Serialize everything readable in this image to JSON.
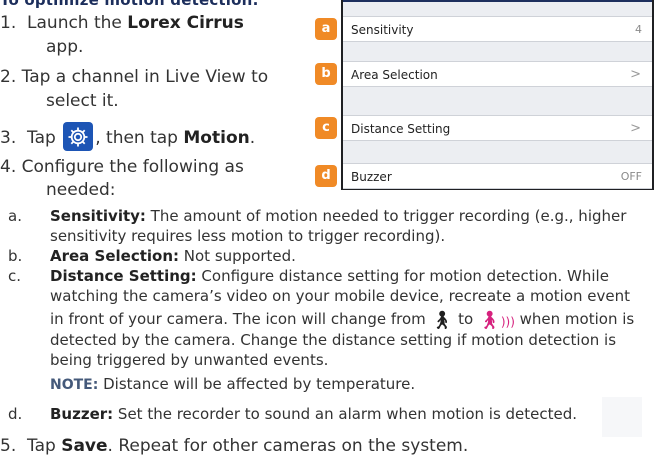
{
  "heading": "To optimize motion detection:",
  "steps": {
    "s1_prefix": "1.  Launch the ",
    "s1_bold": "Lorex Cirrus",
    "s1_cont": "app.",
    "s2_line1": "2.  Tap a channel in Live View to",
    "s2_line2": "select it.",
    "s3_prefix": "3.  Tap ",
    "s3_middle": ", then tap ",
    "s3_bold": "Motion",
    "s3_suffix": ".",
    "s4_line1": "4.  Configure the following as",
    "s4_line2": "needed:",
    "s5_prefix": "5.  Tap ",
    "s5_bold": "Save",
    "s5_suffix": ". Repeat for other cameras on the system."
  },
  "panel": {
    "rows": [
      {
        "badge": "a",
        "label": "Sensitivity",
        "value": "4"
      },
      {
        "badge": "b",
        "label": "Area Selection",
        "value": ">"
      },
      {
        "badge": "c",
        "label": "Distance Setting",
        "value": ">"
      },
      {
        "badge": "d",
        "label": "Buzzer",
        "value": "OFF"
      }
    ]
  },
  "items": {
    "a_letter": "a.",
    "a_bold": "Sensitivity:",
    "a_text1": " The amount of motion needed to trigger recording (e.g., higher",
    "a_text2": "sensitivity requires less motion to trigger recording).",
    "b_letter": "b.",
    "b_bold": "Area Selection:",
    "b_text": " Not supported.",
    "c_letter": "c.",
    "c_bold": "Distance Setting:",
    "c_text1": " Configure distance setting for motion detection. While",
    "c_text2": "watching the camera’s video on your mobile device, recreate a motion event",
    "c_text3a": "in front of your camera. The icon will change from ",
    "c_text3b": " to ",
    "c_text3c": " when motion is",
    "c_text4": "detected by the camera. Change the distance setting if motion detection is",
    "c_text5": "being triggered by unwanted events.",
    "note_label": "NOTE:",
    "note_text": " Distance will be affected by temperature.",
    "d_letter": "d.",
    "d_bold": "Buzzer:",
    "d_text": " Set the recorder to sound an alarm when motion is detected."
  },
  "icons": {
    "gear": "gear-icon",
    "walk_plain": "walking-person-icon",
    "walk_motion": "walking-person-motion-icon"
  },
  "colors": {
    "badge": "#f08a26",
    "gear_bg": "#1d55b5",
    "heading": "#1c2e5c",
    "motion_icon": "#d6227e"
  }
}
